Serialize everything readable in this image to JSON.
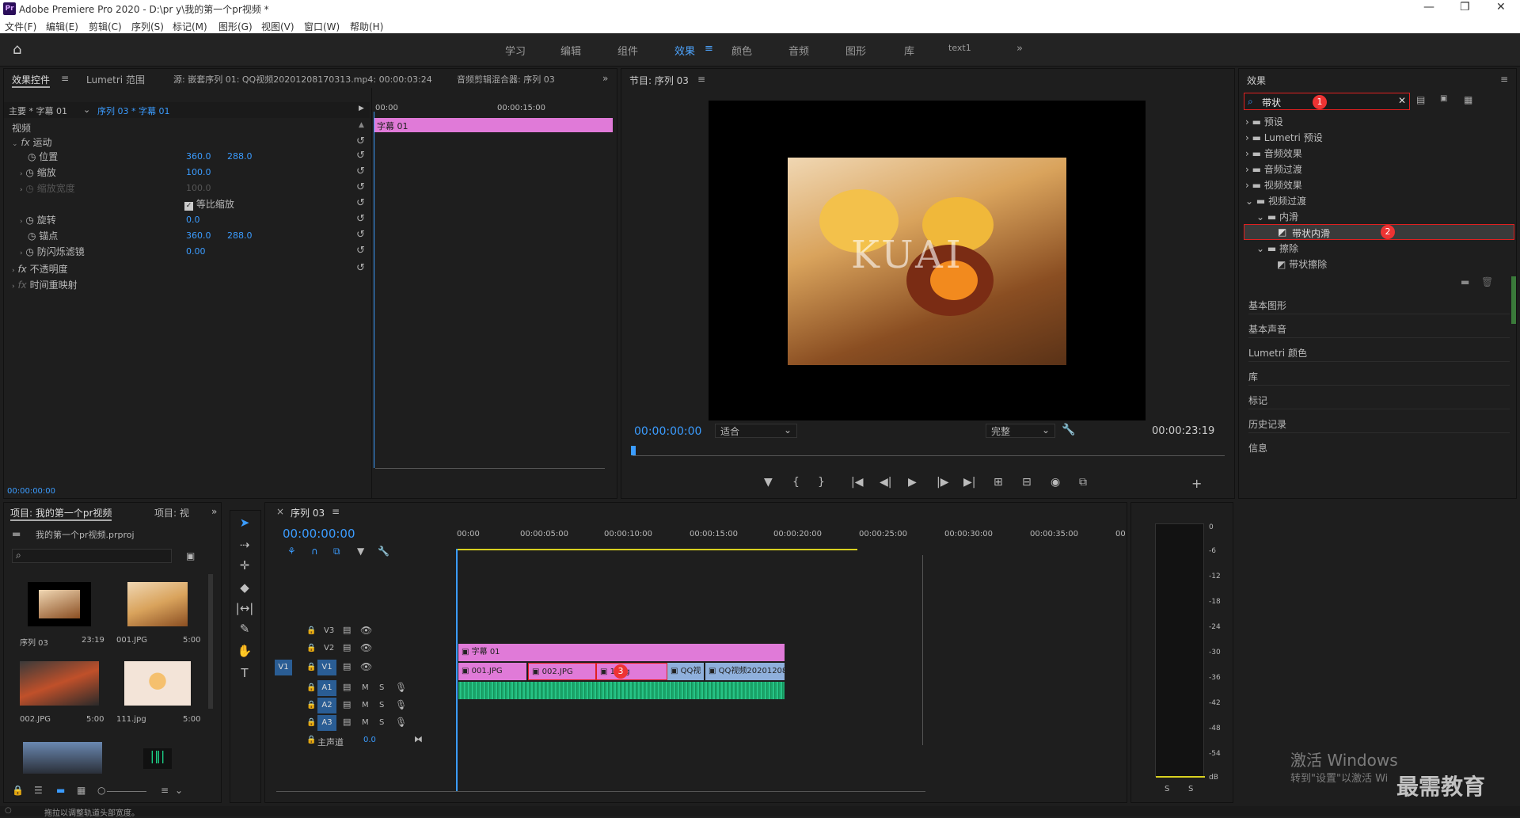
{
  "app": {
    "title": "Adobe Premiere Pro 2020 - D:\\pr y\\我的第一个pr视频 *",
    "logo": "Pr"
  },
  "menu": [
    "文件(F)",
    "编辑(E)",
    "剪辑(C)",
    "序列(S)",
    "标记(M)",
    "图形(G)",
    "视图(V)",
    "窗口(W)",
    "帮助(H)"
  ],
  "workspaces": [
    "学习",
    "编辑",
    "组件",
    "效果",
    "颜色",
    "音频",
    "图形",
    "库",
    "text1"
  ],
  "active_workspace": "效果",
  "effect_controls": {
    "tabs": [
      "效果控件",
      "Lumetri 范围",
      "源: 嵌套序列 01: QQ视频20201208170313.mp4: 00:00:03:24",
      "音频剪辑混合器: 序列 03"
    ],
    "master": "主要 * 字幕 01",
    "sequence": "序列 03 * 字幕 01",
    "section": "视频",
    "motion": "运动",
    "props": [
      {
        "name": "位置",
        "v1": "360.0",
        "v2": "288.0"
      },
      {
        "name": "缩放",
        "v1": "100.0",
        "v2": ""
      },
      {
        "name": "缩放宽度",
        "v1": "100.0",
        "v2": ""
      },
      {
        "name": "等比缩放",
        "v1": "",
        "v2": ""
      },
      {
        "name": "旋转",
        "v1": "0.0",
        "v2": ""
      },
      {
        "name": "锚点",
        "v1": "360.0",
        "v2": "288.0"
      },
      {
        "name": "防闪烁滤镜",
        "v1": "0.00",
        "v2": ""
      }
    ],
    "opacity": "不透明度",
    "time_remap": "时间重映射",
    "clip_label": "字幕 01",
    "ruler": [
      "00:00",
      "00:00:15:00"
    ],
    "timecode": "00:00:00:00"
  },
  "program": {
    "title": "节目: 序列 03",
    "overlay_text": "KUAI",
    "timecode": "00:00:00:00",
    "fit": "适合",
    "quality": "完整",
    "duration": "00:00:23:19",
    "buttons": [
      "▼",
      "{",
      "}",
      "|◀",
      "◀|",
      "▶",
      "|▶",
      "▶|",
      "⊞",
      "⊟",
      "◉",
      "⧉",
      "+"
    ]
  },
  "effects": {
    "title": "效果",
    "search": "带状",
    "tree": [
      {
        "label": "预设",
        "level": 0,
        "open": false
      },
      {
        "label": "Lumetri 预设",
        "level": 0,
        "open": false
      },
      {
        "label": "音频效果",
        "level": 0,
        "open": false
      },
      {
        "label": "音频过渡",
        "level": 0,
        "open": false
      },
      {
        "label": "视频效果",
        "level": 0,
        "open": false
      },
      {
        "label": "视频过渡",
        "level": 0,
        "open": true
      },
      {
        "label": "内滑",
        "level": 1,
        "open": true
      },
      {
        "label": "带状内滑",
        "level": 2,
        "open": false
      },
      {
        "label": "擦除",
        "level": 1,
        "open": true
      },
      {
        "label": "带状擦除",
        "level": 2,
        "open": false
      }
    ],
    "sections": [
      "基本图形",
      "基本声音",
      "Lumetri 颜色",
      "库",
      "标记",
      "历史记录",
      "信息"
    ],
    "markers": [
      "1",
      "2",
      "3"
    ]
  },
  "project": {
    "tabs": [
      "项目: 我的第一个pr视频",
      "项目: 视"
    ],
    "file": "我的第一个pr视频.prproj",
    "items": [
      {
        "name": "序列 03",
        "dur": "23:19"
      },
      {
        "name": "001.JPG",
        "dur": "5:00"
      },
      {
        "name": "002.JPG",
        "dur": "5:00"
      },
      {
        "name": "111.jpg",
        "dur": "5:00"
      }
    ]
  },
  "timeline": {
    "title": "序列 03",
    "timecode": "00:00:00:00",
    "ruler": [
      "00:00",
      "00:00:05:00",
      "00:00:10:00",
      "00:00:15:00",
      "00:00:20:00",
      "00:00:25:00",
      "00:00:30:00",
      "00:00:35:00",
      "00"
    ],
    "tracks": [
      "V3",
      "V2",
      "V1",
      "A1",
      "A2",
      "A3"
    ],
    "master": "主声道",
    "master_val": "0.0",
    "source_v1": "V1",
    "clips": {
      "v2": "字幕 01",
      "v1": [
        "001.JPG",
        "002.JPG",
        "1.jpg",
        "QQ视",
        "QQ视频202012081703"
      ]
    }
  },
  "meter": {
    "ticks": [
      "0",
      "-6",
      "-12",
      "-18",
      "-24",
      "-30",
      "-36",
      "-42",
      "-48",
      "-54",
      "dB"
    ],
    "solo": [
      "S",
      "S"
    ]
  },
  "watermark": {
    "line1": "激活 Windows",
    "line2": "转到\"设置\"以激活 Wi",
    "brand": "最需教育"
  },
  "status": "拖拉以调整轨道头部宽度。"
}
